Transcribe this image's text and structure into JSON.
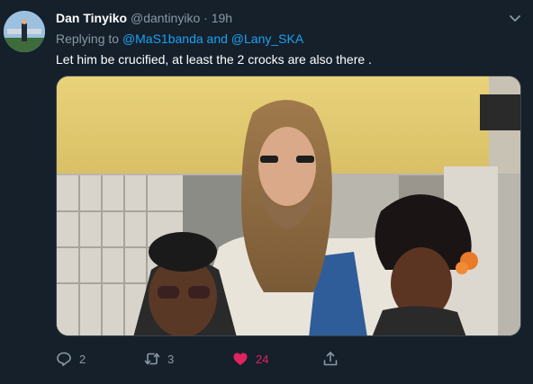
{
  "tweet": {
    "author_name": "Dan Tinyiko",
    "author_handle": "@dantinyiko",
    "separator": "·",
    "time": "19h",
    "replying_prefix": "Replying to ",
    "mention_1": "@MaS1banda",
    "and_text": " and ",
    "mention_2": "@Lany_SKA",
    "text": "Let him be crucified, at least the 2 crocks are also there ."
  },
  "actions": {
    "reply_count": "2",
    "retweet_count": "3",
    "like_count": "24"
  },
  "colors": {
    "background": "#15202b",
    "secondary_text": "#8899a6",
    "link": "#1da1f2",
    "like": "#e0245e"
  },
  "icons": [
    "chevron-down-icon",
    "reply-icon",
    "retweet-icon",
    "heart-icon",
    "share-icon"
  ]
}
